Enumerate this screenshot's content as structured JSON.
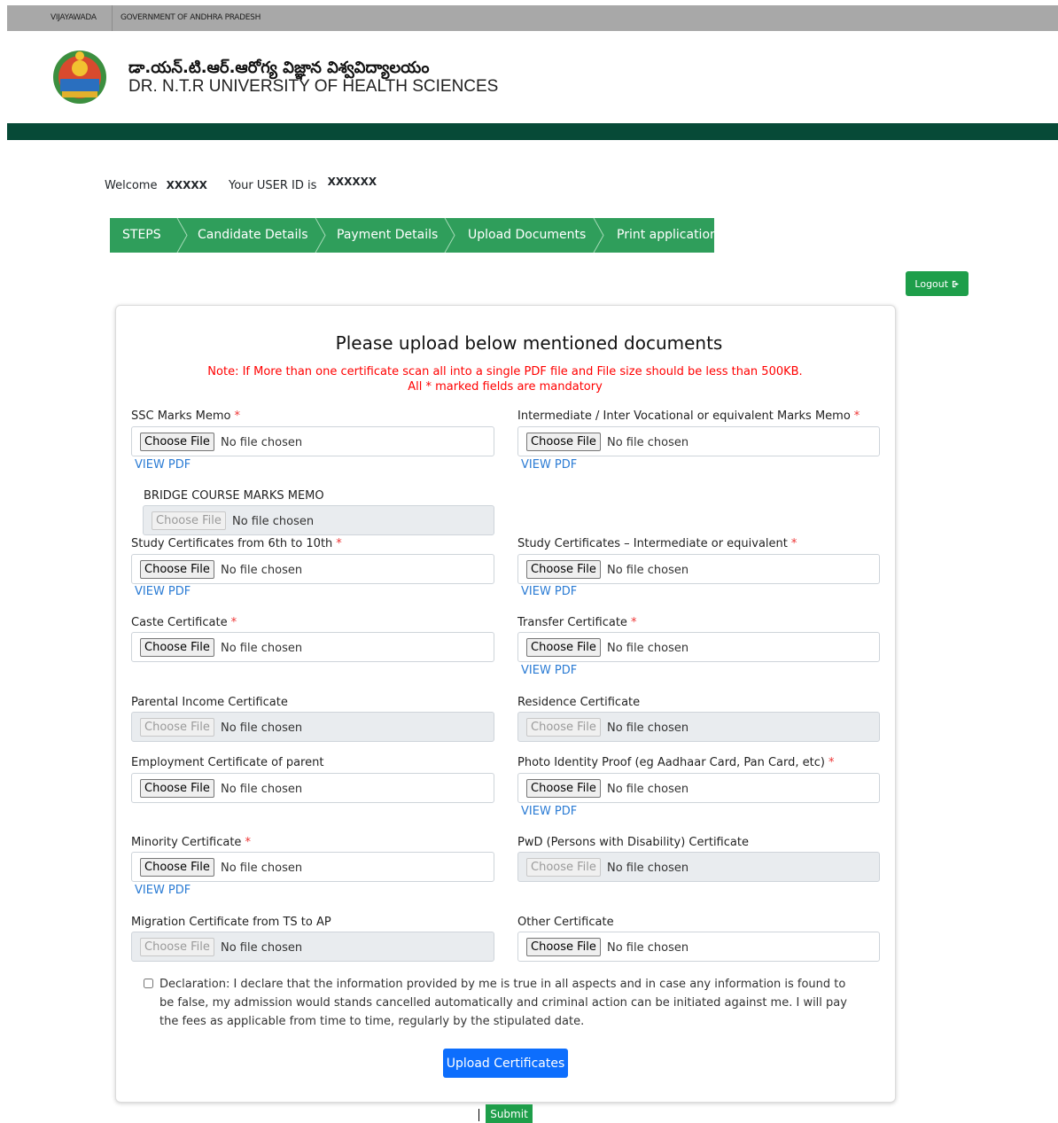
{
  "topbar": {
    "left": "VIJAYAWADA",
    "right": "GOVERNMENT OF ANDHRA PRADESH"
  },
  "header": {
    "title_te": "డా.యన్.టి.ఆర్.ఆరోగ్య విజ్ఞాన విశ్వవిద్యాలయం",
    "title_en": "DR. N.T.R UNIVERSITY OF HEALTH SCIENCES"
  },
  "welcome": {
    "prefix": "Welcome",
    "name": "XXXXX",
    "userid_label": "Your USER ID is",
    "userid": "XXXXXX"
  },
  "steps": [
    "STEPS",
    "Candidate Details",
    "Payment Details",
    "Upload Documents",
    "Print application"
  ],
  "logout": {
    "label": "Logout"
  },
  "form": {
    "heading": "Please upload below mentioned documents",
    "note1": "Note: If More than one certificate scan all into a single PDF file and File size should be less than 500KB.",
    "note2": "All * marked fields are mandatory",
    "choose_label": "Choose File",
    "no_file": "No file chosen",
    "view_pdf": "VIEW PDF",
    "required_mark": "*",
    "fields": [
      {
        "label": "SSC Marks Memo"
      },
      {
        "label": "Intermediate / Inter Vocational or equivalent Marks Memo"
      },
      {
        "label": "BRIDGE COURSE MARKS MEMO"
      },
      {
        "label": "Study Certificates from 6th to 10th"
      },
      {
        "label": "Study Certificates – Intermediate or equivalent"
      },
      {
        "label": "Caste Certificate"
      },
      {
        "label": "Transfer Certificate"
      },
      {
        "label": "Parental Income Certificate"
      },
      {
        "label": "Residence Certificate"
      },
      {
        "label": "Employment Certificate of parent"
      },
      {
        "label": "Photo Identity Proof (eg Aadhaar Card, Pan Card, etc)"
      },
      {
        "label": "Minority Certificate"
      },
      {
        "label": "PwD (Persons with Disability) Certificate"
      },
      {
        "label": "Migration Certificate from TS to AP"
      },
      {
        "label": "Other Certificate"
      }
    ],
    "declaration": "Declaration: I declare that the information provided by me is true in all aspects and in case any information is found to be false, my admission would stands cancelled automatically and criminal action can be initiated against me. I will pay the fees as applicable from time to time, regularly by the stipulated date.",
    "upload_label": "Upload Certificates",
    "submit_label": "Submit"
  },
  "colors": {
    "header_band": "#074a37",
    "steps_bg": "#2f9e5b",
    "accent_blue": "#0d6efd",
    "required": "#ff0000"
  },
  "icons": {
    "logout": "sign-out-icon",
    "logo": "university-seal-logo"
  }
}
